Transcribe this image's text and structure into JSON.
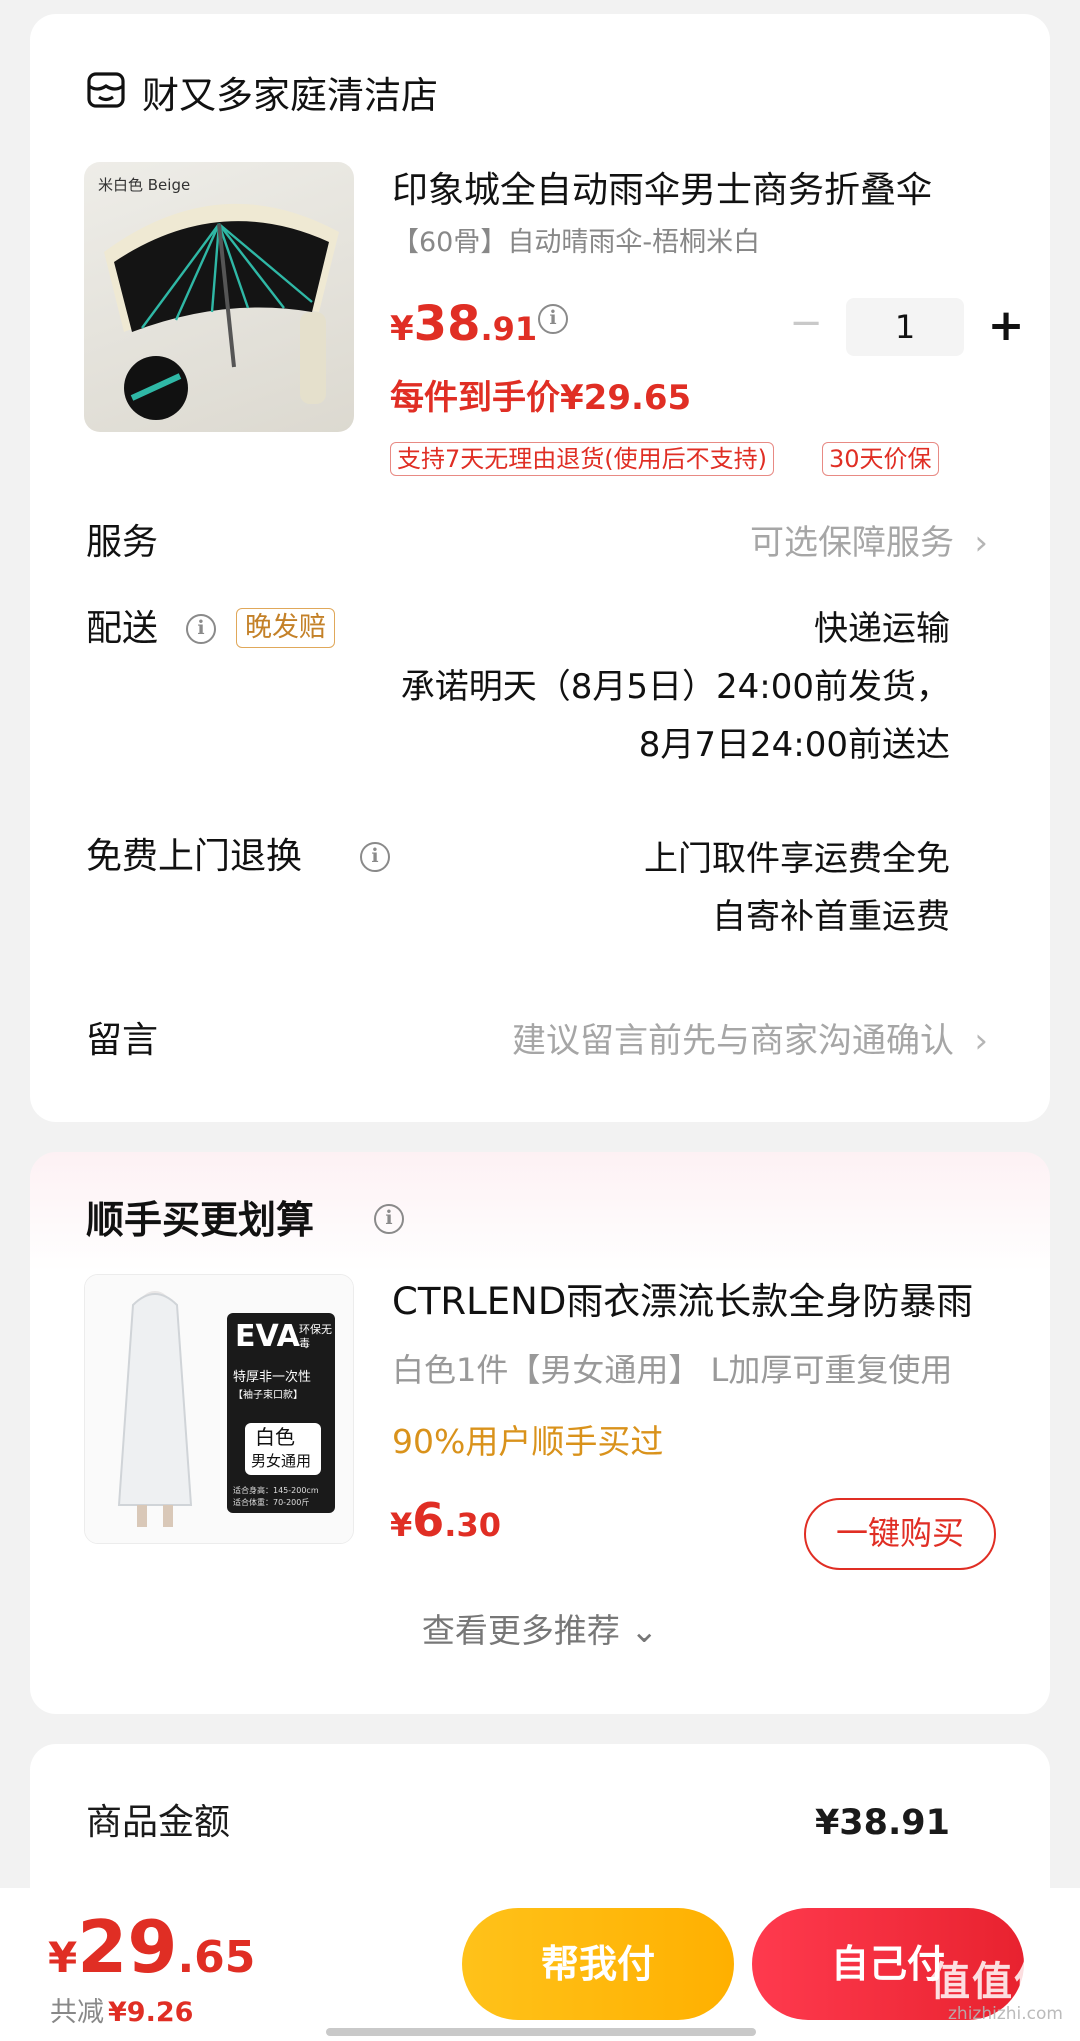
{
  "shop": {
    "name": "财又多家庭清洁店"
  },
  "product": {
    "image_tag": "米白色 Beige",
    "title": "印象城全自动雨伞男士商务折叠伞",
    "spec": "【60骨】自动晴雨伞-梧桐米白",
    "price_symbol": "¥",
    "price_int": "38",
    "price_dec": ".91",
    "quantity": "1",
    "minus": "−",
    "plus": "+",
    "deal_price": "每件到手价¥29.65",
    "badges": [
      "支持7天无理由退货(使用后不支持)",
      "30天价保"
    ]
  },
  "service": {
    "label": "服务",
    "value": "可选保障服务"
  },
  "delivery": {
    "label": "配送",
    "late_tag": "晚发赔",
    "method": "快递运输",
    "promise_line1": "承诺明天（8月5日）24:00前发货，",
    "promise_line2": "8月7日24:00前送达"
  },
  "returns": {
    "label": "免费上门退换",
    "line1": "上门取件享运费全免",
    "line2": "自寄补首重运费"
  },
  "message": {
    "label": "留言",
    "placeholder": "建议留言前先与商家沟通确认"
  },
  "recommend": {
    "title": "顺手买更划算",
    "item": {
      "name": "CTRLEND雨衣漂流长款全身防暴雨",
      "spec": "白色1件【男女通用】 L加厚可重复使用",
      "social": "90%用户顺手买过",
      "price_symbol": "¥",
      "price_int": "6",
      "price_dec": ".30",
      "buy_label": "一键购买",
      "image_lines": [
        "EVA",
        "环保无毒",
        "特厚非一次性",
        "【袖子束口款】",
        "白色",
        "男女通用",
        "适合身高：145-200cm",
        "适合体重：70-200斤"
      ]
    },
    "more": "查看更多推荐 ⌄"
  },
  "summary": {
    "goods_label": "商品金额",
    "goods_value": "¥38.91"
  },
  "bottom": {
    "total_symbol": "¥",
    "total_int": "29",
    "total_dec": ".65",
    "saved_label": "共减",
    "saved_value": "¥9.26",
    "help_pay": "帮我付",
    "self_pay": "自己付",
    "watermark": "值值值",
    "watermark_sub": "zhizhizhi.com"
  },
  "colors": {
    "accent_red": "#e02e24",
    "pay_yellow": "#ffb000",
    "social_gold": "#d9921b"
  }
}
